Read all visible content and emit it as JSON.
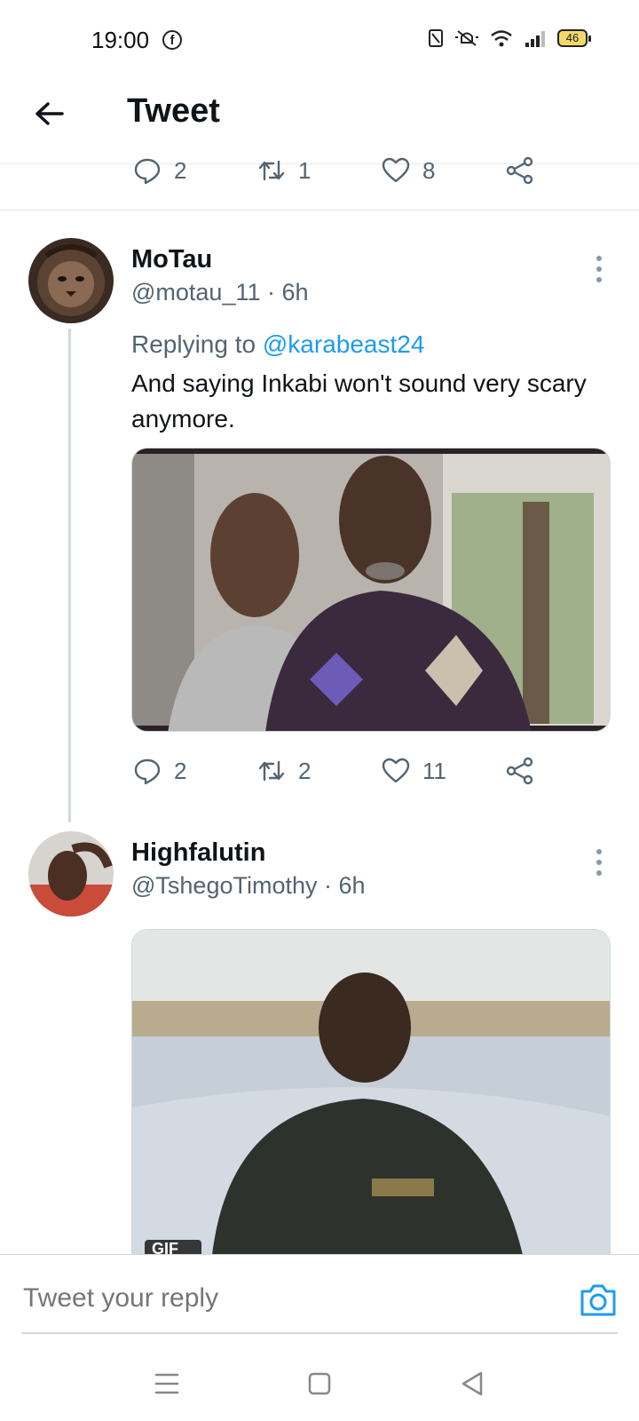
{
  "status_bar": {
    "time": "19:00",
    "battery": "46"
  },
  "header": {
    "title": "Tweet"
  },
  "top_actions": {
    "replies": "2",
    "retweets": "1",
    "likes": "8"
  },
  "tweets": [
    {
      "name": "MoTau",
      "handle_time": "@motau_11 · 6h",
      "replying_prefix": "Replying to ",
      "replying_to": "@karabeast24",
      "text": "And saying Inkabi won't sound very scary anymore.",
      "actions": {
        "replies": "2",
        "retweets": "2",
        "likes": "11"
      }
    },
    {
      "name": "Highfalutin",
      "handle_time": "@TshegoTimothy · 6h",
      "media_badge": "GIF"
    }
  ],
  "reply_bar": {
    "placeholder": "Tweet your reply"
  },
  "icons": {
    "back": "arrow-left-icon",
    "reply": "speech-bubble-icon",
    "retweet": "retweet-icon",
    "like": "heart-icon",
    "share": "share-icon",
    "more": "vertical-dots-icon",
    "camera": "camera-icon"
  },
  "colors": {
    "accent": "#1d9bf0",
    "secondary_text": "#536471",
    "divider": "#e7e9ea"
  }
}
